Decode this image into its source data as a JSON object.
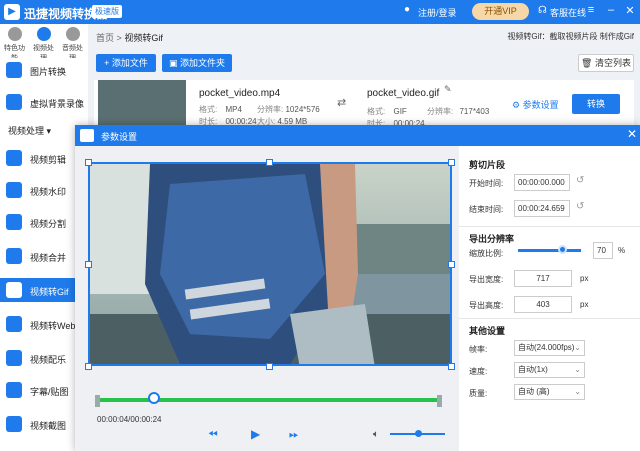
{
  "app": {
    "name": "迅捷视频转换器",
    "version_badge": "极速版",
    "login": "注册/登录",
    "vip": "开通VIP",
    "service": "客服在线"
  },
  "topnav": [
    {
      "label": "特色功能"
    },
    {
      "label": "视频处理"
    },
    {
      "label": "音频处理"
    }
  ],
  "sidebar": {
    "items": [
      "图片转换",
      "虚拟背景录像",
      "视频剪辑",
      "视频水印",
      "视频分割",
      "视频合并",
      "视频转Gif",
      "视频转Webp",
      "视频配乐",
      "字幕/贴图",
      "视频截图"
    ],
    "section": "视频处理",
    "active_index": 6
  },
  "main": {
    "breadcrumb": {
      "home": "首页",
      "sep": ">",
      "current": "视频转Gif"
    },
    "hint": "视频转Gif：截取视频片段 制作成Gif",
    "add_file": "+ 添加文件",
    "add_folder": "添加文件夹",
    "clear_list": "清空列表",
    "file": {
      "src_name": "pocket_video.mp4",
      "src_format_label": "格式:",
      "src_format": "MP4",
      "src_res_label": "分辨率:",
      "src_res": "1024*576",
      "src_time_label": "时长:",
      "src_time": "00:00:24",
      "src_size_label": "大小:",
      "src_size": "4.59 MB",
      "dst_name": "pocket_video.gif",
      "dst_format_label": "格式:",
      "dst_format": "GIF",
      "dst_res_label": "分辨率:",
      "dst_res": "717*403",
      "dst_time_label": "时长:",
      "dst_time": "00:00:24",
      "param_link": "参数设置",
      "convert": "转换"
    }
  },
  "modal": {
    "title": "参数设置",
    "time_text": "00:00:04/00:00:24",
    "cut": {
      "title": "剪切片段",
      "start_label": "开始时间:",
      "start": "00:00:00.000",
      "end_label": "结束时间:",
      "end": "00:00:24.659"
    },
    "res": {
      "title": "导出分辨率",
      "scale_label": "缩放比例:",
      "scale": "70",
      "scale_unit": "%",
      "width_label": "导出宽度:",
      "width": "717",
      "width_unit": "px",
      "height_label": "导出高度:",
      "height": "403",
      "height_unit": "px"
    },
    "other": {
      "title": "其他设置",
      "fps_label": "帧率:",
      "fps": "自动(24.000fps)",
      "speed_label": "速度:",
      "speed": "自动(1x)",
      "quality_label": "质量:",
      "quality": "自动 (高)"
    },
    "playhead_fraction": 0.1667,
    "scale_fraction": 0.7,
    "volume_fraction": 0.5
  },
  "colors": {
    "accent": "#1f7bec",
    "timeline": "#26c24a"
  }
}
